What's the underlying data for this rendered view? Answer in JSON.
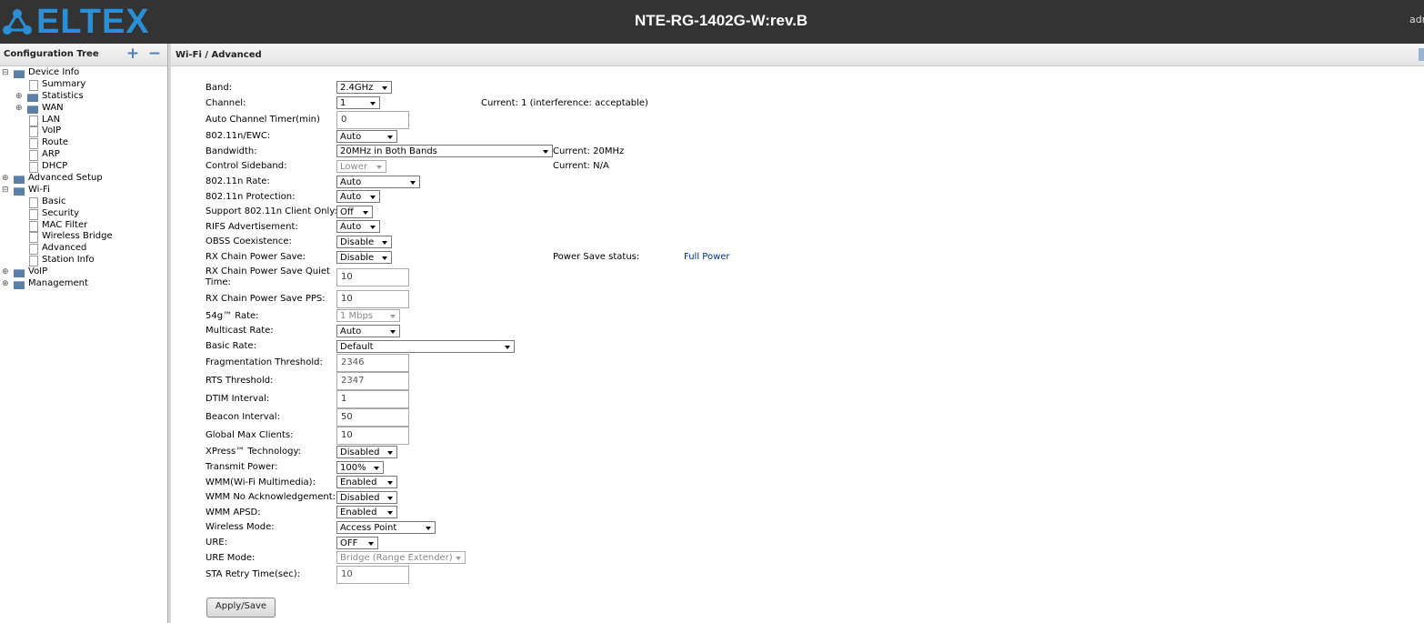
{
  "header": {
    "logo": "ELTEX",
    "device_title": "NTE-RG-1402G-W:rev.B",
    "user": "admin"
  },
  "sidebar": {
    "title": "Configuration Tree",
    "expand_icon": "plus-icon",
    "collapse_icon": "minus-icon",
    "tree": [
      {
        "label": "Device Info",
        "level": 1,
        "type": "folder",
        "expanded": true
      },
      {
        "label": "Summary",
        "level": 2,
        "type": "doc"
      },
      {
        "label": "Statistics",
        "level": 2,
        "type": "folder",
        "expanded": false
      },
      {
        "label": "WAN",
        "level": 2,
        "type": "folder",
        "expanded": false
      },
      {
        "label": "LAN",
        "level": 2,
        "type": "doc"
      },
      {
        "label": "VoIP",
        "level": 2,
        "type": "doc"
      },
      {
        "label": "Route",
        "level": 2,
        "type": "doc"
      },
      {
        "label": "ARP",
        "level": 2,
        "type": "doc"
      },
      {
        "label": "DHCP",
        "level": 2,
        "type": "doc"
      },
      {
        "label": "Advanced Setup",
        "level": 1,
        "type": "folder",
        "expanded": false
      },
      {
        "label": "Wi-Fi",
        "level": 1,
        "type": "folder",
        "expanded": true
      },
      {
        "label": "Basic",
        "level": 2,
        "type": "doc"
      },
      {
        "label": "Security",
        "level": 2,
        "type": "doc"
      },
      {
        "label": "MAC Filter",
        "level": 2,
        "type": "doc"
      },
      {
        "label": "Wireless Bridge",
        "level": 2,
        "type": "doc"
      },
      {
        "label": "Advanced",
        "level": 2,
        "type": "doc"
      },
      {
        "label": "Station Info",
        "level": 2,
        "type": "doc"
      },
      {
        "label": "VoIP",
        "level": 1,
        "type": "folder",
        "expanded": false
      },
      {
        "label": "Management",
        "level": 1,
        "type": "folder",
        "expanded": false
      }
    ]
  },
  "content": {
    "breadcrumb": "Wi-Fi / Advanced",
    "fields": {
      "band": {
        "label": "Band:",
        "value": "2.4GHz"
      },
      "channel": {
        "label": "Channel:",
        "value": "1",
        "info": "Current: 1 (interference: acceptable)"
      },
      "auto_channel_timer": {
        "label": "Auto Channel Timer(min)",
        "value": "0"
      },
      "ewc": {
        "label": "802.11n/EWC:",
        "value": "Auto"
      },
      "bandwidth": {
        "label": "Bandwidth:",
        "value": "20MHz in Both Bands",
        "info": "Current: 20MHz"
      },
      "control_sideband": {
        "label": "Control Sideband:",
        "value": "Lower",
        "info": "Current: N/A"
      },
      "n_rate": {
        "label": "802.11n Rate:",
        "value": "Auto"
      },
      "n_protection": {
        "label": "802.11n Protection:",
        "value": "Auto"
      },
      "n_client_only": {
        "label": "Support 802.11n Client Only:",
        "value": "Off"
      },
      "rifs": {
        "label": "RIFS Advertisement:",
        "value": "Auto"
      },
      "obss": {
        "label": "OBSS Coexistence:",
        "value": "Disable"
      },
      "rx_power_save": {
        "label": "RX Chain Power Save:",
        "value": "Disable",
        "info_label": "Power Save status:",
        "info_value": "Full Power"
      },
      "rx_quiet_time": {
        "label": "RX Chain Power Save Quiet Time:",
        "value": "10"
      },
      "rx_pps": {
        "label": "RX Chain Power Save PPS:",
        "value": "10"
      },
      "rate_54g": {
        "label": "54g™ Rate:",
        "value": "1 Mbps"
      },
      "multicast_rate": {
        "label": "Multicast Rate:",
        "value": "Auto"
      },
      "basic_rate": {
        "label": "Basic Rate:",
        "value": "Default"
      },
      "frag_threshold": {
        "label": "Fragmentation Threshold:",
        "value": "2346"
      },
      "rts_threshold": {
        "label": "RTS Threshold:",
        "value": "2347"
      },
      "dtim": {
        "label": "DTIM Interval:",
        "value": "1"
      },
      "beacon": {
        "label": "Beacon Interval:",
        "value": "50"
      },
      "max_clients": {
        "label": "Global Max Clients:",
        "value": "10"
      },
      "xpress": {
        "label": "XPress™ Technology:",
        "value": "Disabled"
      },
      "tx_power": {
        "label": "Transmit Power:",
        "value": "100%"
      },
      "wmm": {
        "label": "WMM(Wi-Fi Multimedia):",
        "value": "Enabled"
      },
      "wmm_noack": {
        "label": "WMM No Acknowledgement:",
        "value": "Disabled"
      },
      "wmm_apsd": {
        "label": "WMM APSD:",
        "value": "Enabled"
      },
      "wireless_mode": {
        "label": "Wireless Mode:",
        "value": "Access Point"
      },
      "ure": {
        "label": "URE:",
        "value": "OFF"
      },
      "ure_mode": {
        "label": "URE Mode:",
        "value": "Bridge (Range Extender)"
      },
      "sta_retry": {
        "label": "STA Retry Time(sec):",
        "value": "10"
      }
    },
    "apply_button": "Apply/Save"
  }
}
